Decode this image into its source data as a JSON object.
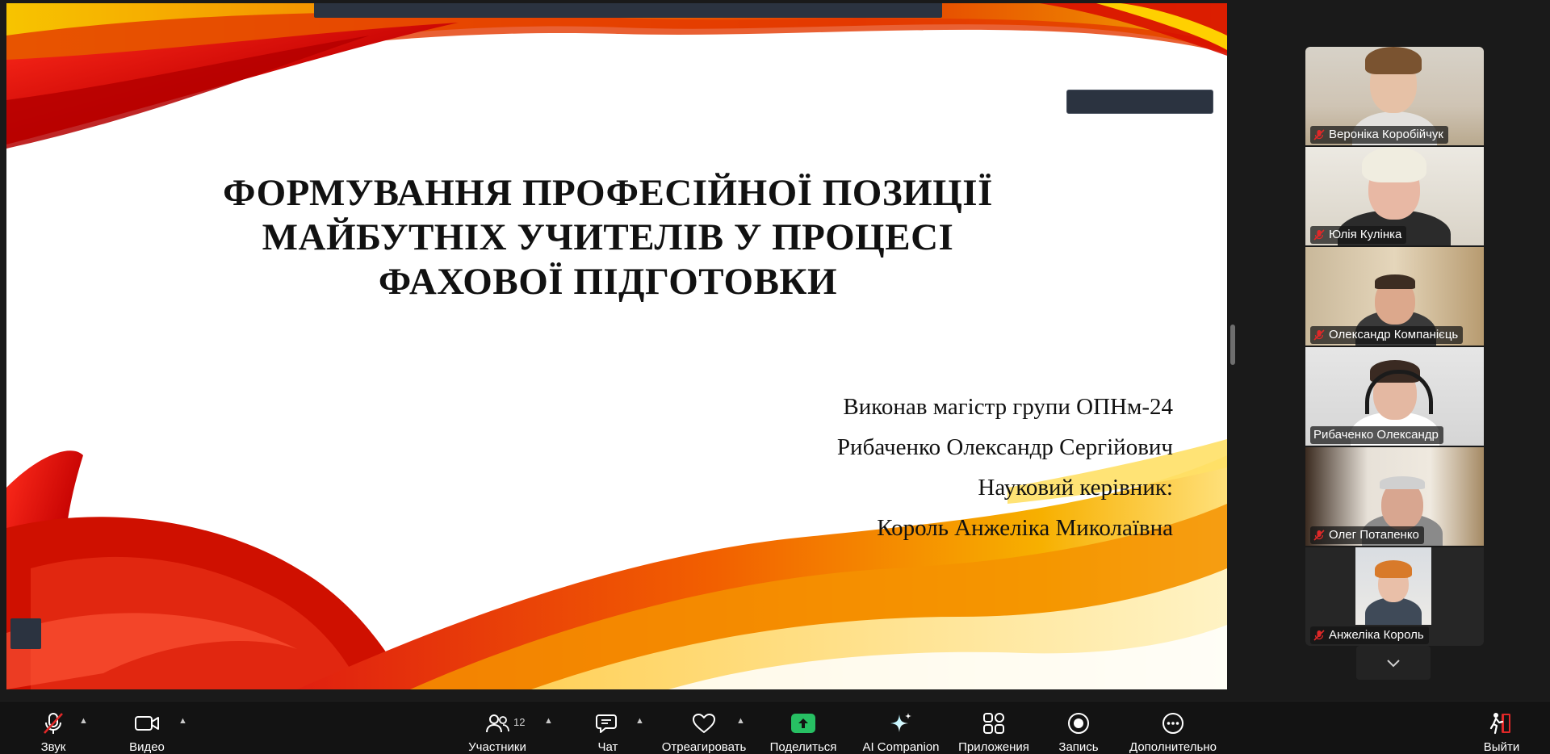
{
  "slide": {
    "title_lines": [
      "ФОРМУВАННЯ ПРОФЕСІЙНОЇ ПОЗИЦІЇ",
      "МАЙБУТНІХ УЧИТЕЛІВ У ПРОЦЕСІ",
      "ФАХОВОЇ ПІДГОТОВКИ"
    ],
    "author_lines": [
      "Виконав магістр групи ОПНм-24",
      "Рибаченко Олександр Сергійович",
      "Науковий керівник:",
      "Король Анжеліка Миколаївна"
    ]
  },
  "participants": [
    {
      "name": "Вероніка Коробійчук",
      "muted": true,
      "active": false
    },
    {
      "name": "Юлія Кулінка",
      "muted": true,
      "active": false
    },
    {
      "name": "Олександр Компанієць",
      "muted": true,
      "active": false
    },
    {
      "name": "Рибаченко Олександр",
      "muted": false,
      "active": true
    },
    {
      "name": "Олег Потапенко",
      "muted": true,
      "active": false
    },
    {
      "name": "Анжеліка Король",
      "muted": true,
      "active": false
    }
  ],
  "toolbar": {
    "audio_label": "Звук",
    "video_label": "Видео",
    "participants_label": "Участники",
    "participants_count": "12",
    "chat_label": "Чат",
    "react_label": "Отреагировать",
    "share_label": "Поделиться",
    "ai_label": "AI Companion",
    "apps_label": "Приложения",
    "record_label": "Запись",
    "more_label": "Дополнительно",
    "leave_label": "Выйти"
  },
  "colors": {
    "active_speaker": "#2fd37a",
    "share_button": "#27c063",
    "leave_icon": "#e02828",
    "muted_icon": "#e02828"
  },
  "icons": {
    "audio": "mic-muted-icon",
    "video": "camera-icon",
    "participants": "people-icon",
    "chat": "chat-bubble-icon",
    "react": "heart-icon",
    "share": "share-up-arrow-icon",
    "ai": "sparkle-icon",
    "apps": "apps-grid-icon",
    "record": "record-dot-icon",
    "more": "ellipsis-icon",
    "leave": "exit-door-icon"
  }
}
